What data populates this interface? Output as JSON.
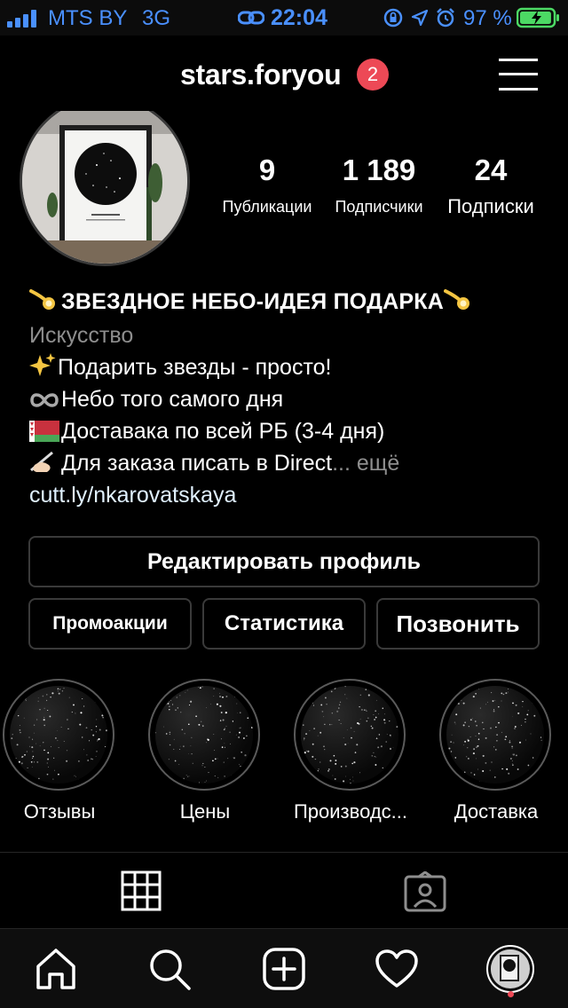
{
  "status_bar": {
    "carrier": "MTS BY",
    "network": "3G",
    "time": "22:04",
    "battery_percent": "97 %",
    "battery_level": 0.97
  },
  "header": {
    "username": "stars.foryou",
    "notification_count": "2"
  },
  "stats": {
    "posts": {
      "value": "9",
      "label": "Публикации"
    },
    "followers": {
      "value": "1 189",
      "label": "Подписчики"
    },
    "following": {
      "value": "24",
      "label": "Подписки"
    }
  },
  "bio": {
    "title": "ЗВЕЗДНОЕ НЕБО-ИДЕЯ ПОДАРКА",
    "category": "Искусство",
    "line1": "Подарить звезды - просто!",
    "line2": "Небо того самого дня",
    "line3": "Доставака по всей РБ (3-4 дня)",
    "line4": "Для заказа писать в Direct",
    "more": "... ещё",
    "link": "cutt.ly/nkarovatskaya"
  },
  "buttons": {
    "edit_profile": "Редактировать профиль",
    "promotions": "Промоакции",
    "insights": "Статистика",
    "call": "Позвонить"
  },
  "highlights": [
    {
      "label": "Отзывы"
    },
    {
      "label": "Цены"
    },
    {
      "label": "Производс..."
    },
    {
      "label": "Доставка"
    }
  ],
  "tabs": [
    {
      "icon": "grid-icon",
      "active": true
    },
    {
      "icon": "tagged-icon",
      "active": false
    }
  ],
  "nav": {
    "items": [
      "home-icon",
      "search-icon",
      "add-post-icon",
      "activity-heart-icon",
      "profile-avatar"
    ]
  },
  "colors": {
    "background": "#000000",
    "badge": "#ed4956",
    "link": "#e0f1ff",
    "muted": "#8e8e8e",
    "border": "#3a3a3a",
    "battery": "#4cd964"
  }
}
